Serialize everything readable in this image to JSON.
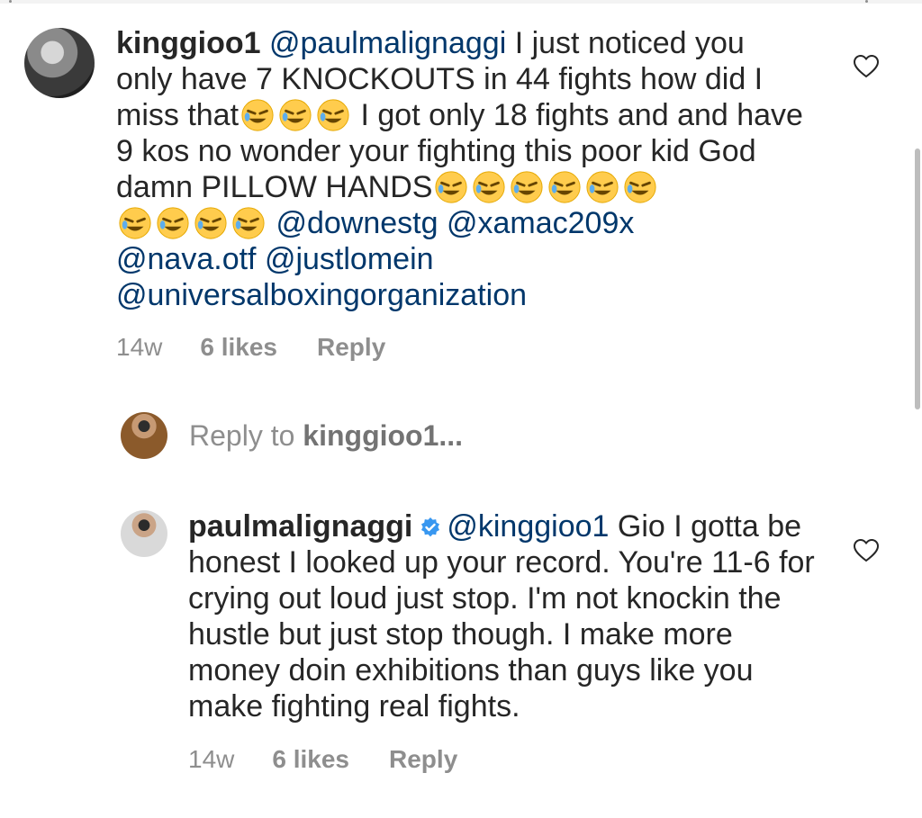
{
  "comment1": {
    "username": "kinggioo1",
    "text_parts": [
      "@paulmalignaggi",
      " I just noticed you only have 7 KNOCKOUTS in 44 fights how did I miss that",
      " I got only 18 fights and and have 9 kos no wonder your fighting this poor kid God damn PILLOW HANDS",
      "@downestg",
      "@xamac209x",
      "@nava.otf",
      "@justlomein",
      "@universalboxingorganization"
    ],
    "time": "14w",
    "likes": "6 likes",
    "reply": "Reply",
    "icon": "heart-icon"
  },
  "reply_field": {
    "prefix": "Reply to ",
    "name": "kinggioo1...",
    "avatar": "user-avatar"
  },
  "comment2": {
    "username": "paulmalignaggi",
    "verified_icon": "verified-badge-icon",
    "text_parts": [
      "@kinggioo1",
      " Gio I gotta be honest I looked up your record.  You're 11-6 for crying out loud just stop.  I'm not knockin the hustle but just stop though.  I make more money doin exhibitions than guys like you make fighting real fights."
    ],
    "time": "14w",
    "likes": "6 likes",
    "reply": "Reply",
    "icon": "heart-icon"
  },
  "colors": {
    "text": "#262626",
    "mention": "#00376b",
    "meta": "#8e8e8e",
    "verified": "#3897f0",
    "emoji": "#ffcc4d"
  }
}
